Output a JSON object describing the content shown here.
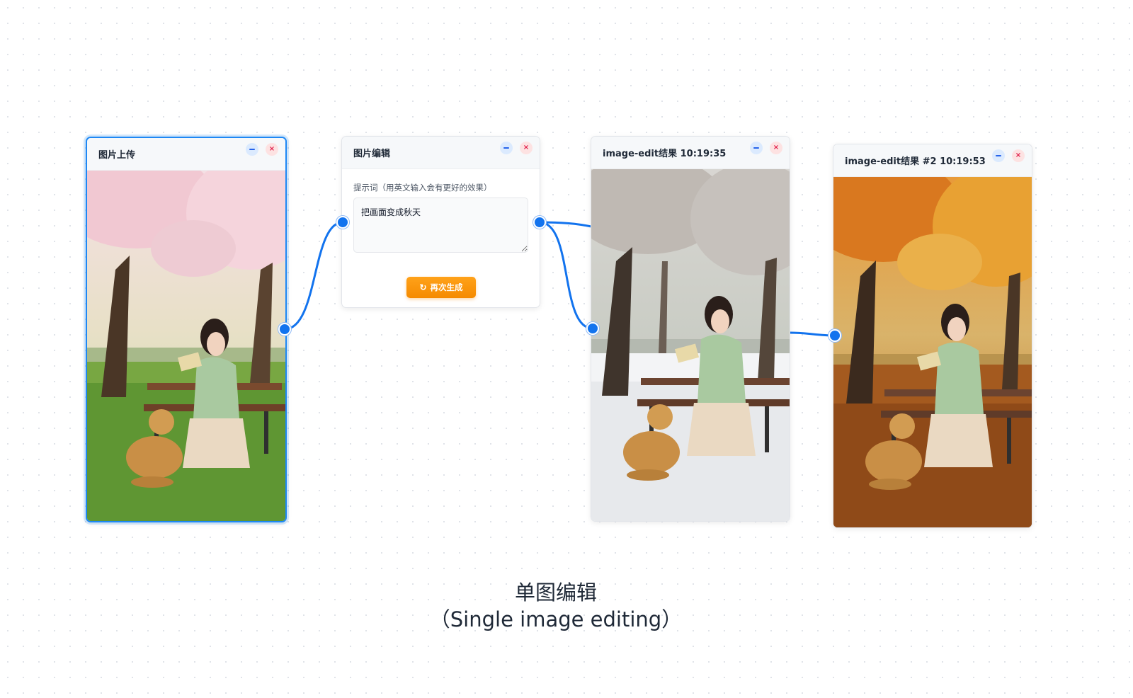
{
  "nodes": {
    "upload": {
      "title": "图片上传"
    },
    "edit": {
      "title": "图片编辑",
      "prompt_label": "提示词（用英文输入会有更好的效果）",
      "prompt_value": "把画面变成秋天",
      "regenerate_label": "再次生成",
      "regenerate_icon": "refresh-icon"
    },
    "result1": {
      "title": "image-edit结果 10:19:35"
    },
    "result2": {
      "title": "image-edit结果 #2 10:19:53"
    }
  },
  "node_controls": {
    "minimize_icon": "minus-icon",
    "close_icon": "close-icon",
    "close_glyph": "×"
  },
  "caption": {
    "title_zh": "单图编辑",
    "title_en": "（Single image editing）"
  },
  "colors": {
    "selection": "#1e88f5",
    "wire": "#1273ee",
    "button": "#f58a00"
  }
}
